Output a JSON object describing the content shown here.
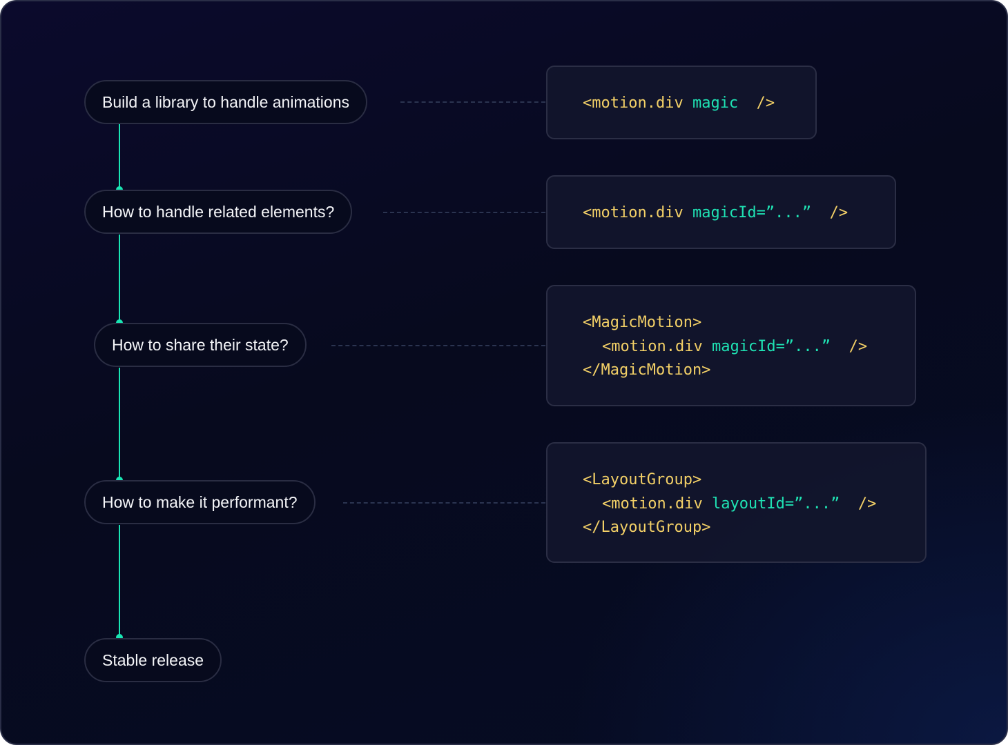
{
  "colors": {
    "accent": "#19e6b4",
    "tag": "#f3d067",
    "attribute": "#1fe3b4",
    "text": "#f4f5f8"
  },
  "steps": [
    {
      "label": "Build a library to handle animations"
    },
    {
      "label": "How to handle related elements?"
    },
    {
      "label": "How to share their state?"
    },
    {
      "label": "How to make it performant?"
    },
    {
      "label": "Stable release"
    }
  ],
  "code_blocks": [
    {
      "lines": [
        {
          "parts": [
            {
              "text": "<motion.div ",
              "kind": "tag"
            },
            {
              "text": "magic",
              "kind": "attr"
            },
            {
              "text": "  />",
              "kind": "tag"
            }
          ]
        }
      ]
    },
    {
      "lines": [
        {
          "parts": [
            {
              "text": "<motion.div ",
              "kind": "tag"
            },
            {
              "text": "magicId=",
              "kind": "attr"
            },
            {
              "text": "”...”",
              "kind": "attr"
            },
            {
              "text": "  />",
              "kind": "tag"
            }
          ]
        }
      ]
    },
    {
      "lines": [
        {
          "parts": [
            {
              "text": "<MagicMotion>",
              "kind": "tag"
            }
          ]
        },
        {
          "parts": [
            {
              "text": "<motion.div ",
              "kind": "tag"
            },
            {
              "text": "magicId=",
              "kind": "attr"
            },
            {
              "text": "”...”",
              "kind": "attr"
            },
            {
              "text": "  />",
              "kind": "tag"
            }
          ]
        },
        {
          "parts": [
            {
              "text": "</MagicMotion>",
              "kind": "tag"
            }
          ]
        }
      ]
    },
    {
      "lines": [
        {
          "parts": [
            {
              "text": "<LayoutGroup>",
              "kind": "tag"
            }
          ]
        },
        {
          "parts": [
            {
              "text": "<motion.div ",
              "kind": "tag"
            },
            {
              "text": "layoutId=",
              "kind": "attr"
            },
            {
              "text": "”...”",
              "kind": "attr"
            },
            {
              "text": "  />",
              "kind": "tag"
            }
          ]
        },
        {
          "parts": [
            {
              "text": "</LayoutGroup>",
              "kind": "tag"
            }
          ]
        }
      ]
    }
  ]
}
